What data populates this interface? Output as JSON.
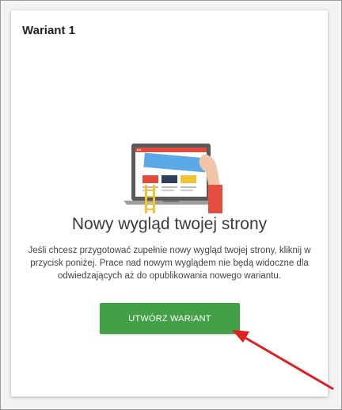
{
  "card": {
    "title": "Wariant 1",
    "headline": "Nowy wygląd twojej strony",
    "description": "Jeśli chcesz przygotować zupełnie nowy wygląd twojej strony, kliknij w przycisk poniżej. Prace nad nowym wyglądem nie będą widoczne dla odwiedzających aż do opublikowania nowego wariantu.",
    "cta_label": "UTWÓRZ WARIANT"
  },
  "colors": {
    "cta_background": "#43a047",
    "annotation_arrow": "#e02020"
  },
  "icons": {
    "illustration": "laptop-with-hand-illustration",
    "annotation": "red-arrow-icon"
  }
}
